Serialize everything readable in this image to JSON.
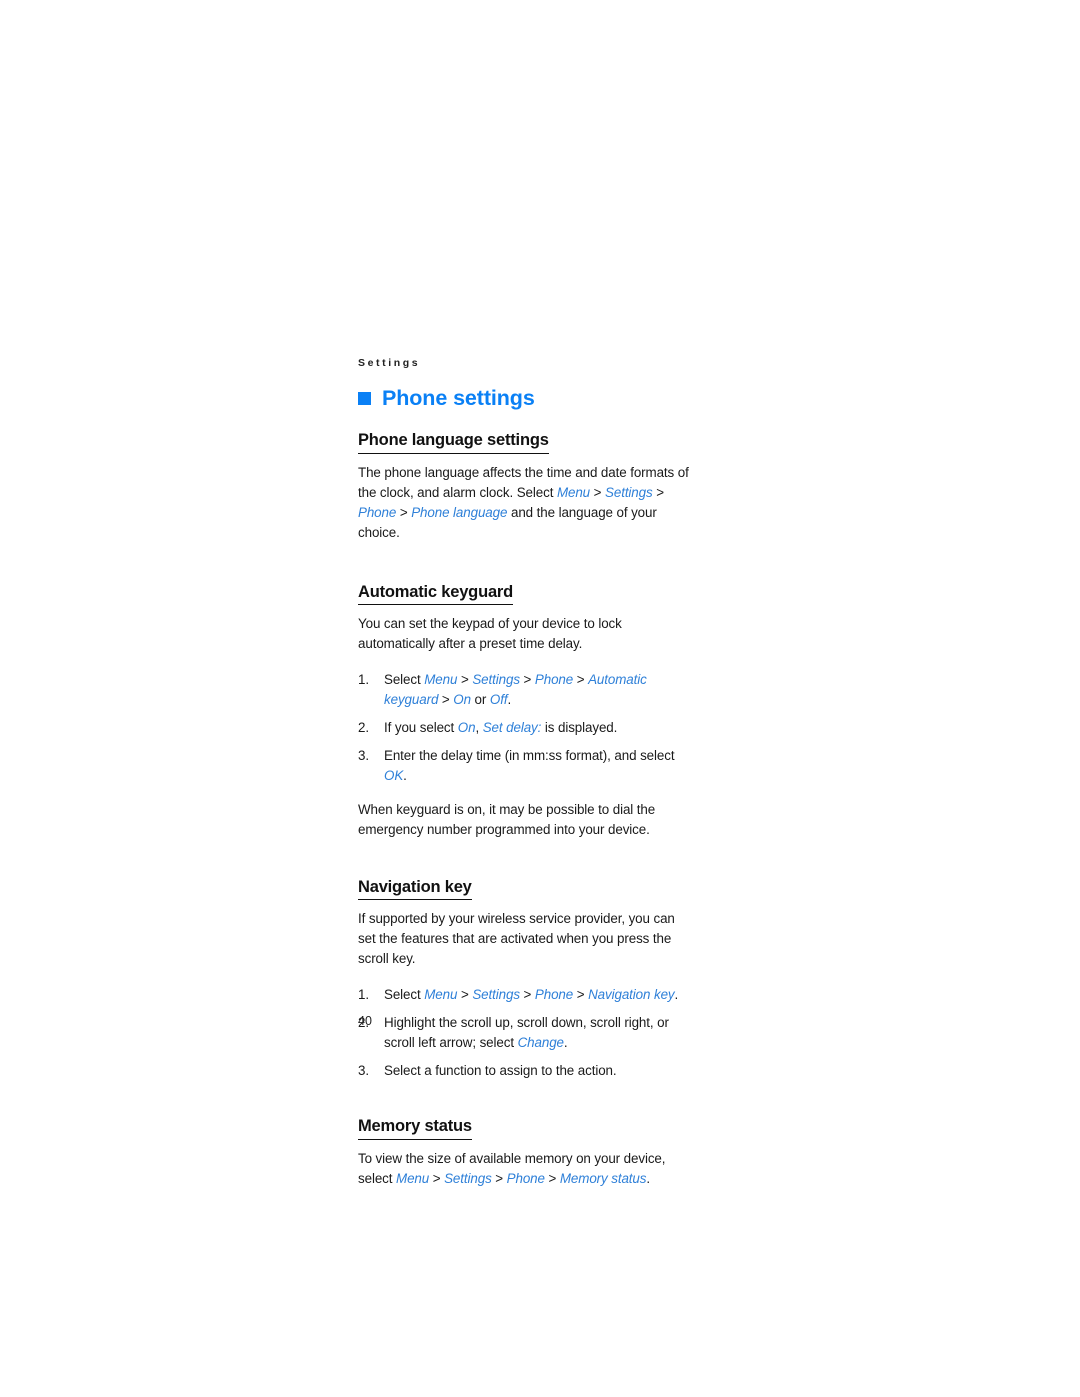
{
  "document": {
    "running_header": "Settings",
    "page_number": "40"
  },
  "chapter": {
    "title": "Phone settings",
    "bullet_color": "#0a80f5",
    "title_color": "#0a80f5"
  },
  "colors": {
    "ui_reference_blue": "#2f80d8",
    "heading_black": "#111111",
    "body_black": "#1a1a1a",
    "page_background": "#ffffff"
  },
  "sections": [
    {
      "heading": "Phone language settings",
      "paragraph_1_part_1": "The phone language affects the time and date formats of the clock, and alarm clock. Select ",
      "ref_menu": "Menu",
      "sep_1": " > ",
      "ref_settings": "Settings",
      "sep_2": " > ",
      "ref_phone": "Phone",
      "sep_3": " > ",
      "ref_phone_language": "Phone language",
      "paragraph_1_part_2": " and the language of your choice."
    },
    {
      "heading": "Automatic keyguard",
      "intro": "You can set the keypad of your device to lock automatically after a preset time delay.",
      "steps": [
        {
          "num": "1.",
          "t1": "Select ",
          "r1": "Menu",
          "s1": " > ",
          "r2": "Settings",
          "s2": " > ",
          "r3": "Phone",
          "s3": " > ",
          "r4": "Automatic keyguard",
          "s4": " > ",
          "r5": "On",
          "t2": " or ",
          "r6": "Off",
          "t3": "."
        },
        {
          "num": "2.",
          "t1": "If you select ",
          "r1": "On",
          "t2": ", ",
          "r2": "Set delay:",
          "t3": " is displayed."
        },
        {
          "num": "3.",
          "t1": "Enter the delay time (in mm:ss format), and select ",
          "r1": "OK",
          "t2": "."
        }
      ],
      "outro": "When keyguard is on, it may be possible to dial the emergency number programmed into your device."
    },
    {
      "heading": "Navigation key",
      "intro": "If supported by your wireless service provider, you can set the features that are activated when you press the scroll key.",
      "steps": [
        {
          "num": "1.",
          "t1": "Select ",
          "r1": "Menu",
          "s1": " > ",
          "r2": "Settings",
          "s2": " > ",
          "r3": "Phone",
          "s3": " > ",
          "r4": "Navigation key",
          "t2": "."
        },
        {
          "num": "2.",
          "t1": "Highlight the scroll up, scroll down, scroll right, or scroll left arrow; select ",
          "r1": "Change",
          "t2": "."
        },
        {
          "num": "3.",
          "t1": "Select a function to assign to the action."
        }
      ]
    },
    {
      "heading": "Memory status",
      "paragraph_part_1": "To view the size of available memory on your device, select ",
      "ref_menu": "Menu",
      "sep_1": " > ",
      "ref_settings": "Settings",
      "sep_2": " > ",
      "ref_phone": "Phone",
      "sep_3": " > ",
      "ref_memory_status": "Memory status",
      "paragraph_part_2": "."
    }
  ]
}
